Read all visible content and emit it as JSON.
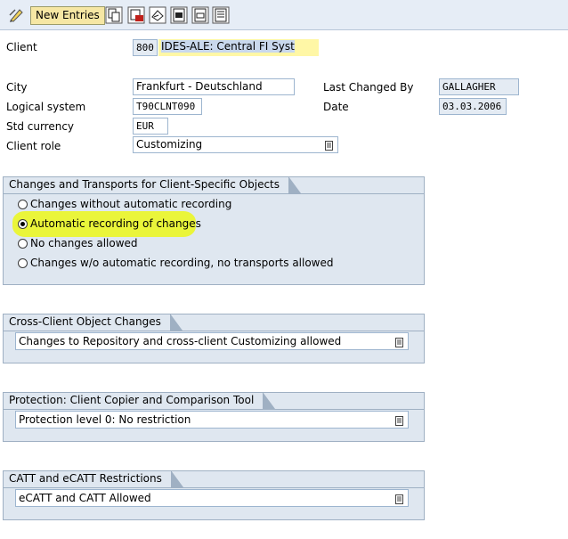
{
  "toolbar": {
    "new_entries_label": "New Entries",
    "icons": [
      "display-change-icon",
      "copy-icon",
      "delete-icon",
      "undo-icon",
      "select-all-icon",
      "select-block-icon",
      "deselect-all-icon"
    ]
  },
  "form": {
    "client_label": "Client",
    "client_value": "800",
    "client_description": "IDES-ALE: Central FI Syst",
    "city_label": "City",
    "city_value": "Frankfurt - Deutschland",
    "logical_system_label": "Logical system",
    "logical_system_value": "T90CLNT090",
    "std_currency_label": "Std currency",
    "std_currency_value": "EUR",
    "client_role_label": "Client role",
    "client_role_value": "Customizing",
    "last_changed_by_label": "Last Changed By",
    "last_changed_by_value": "GALLAGHER",
    "date_label": "Date",
    "date_value": "03.03.2006"
  },
  "changes_group": {
    "title": "Changes and Transports for Client-Specific Objects",
    "options": [
      {
        "label": "Changes without automatic recording",
        "selected": false
      },
      {
        "label": "Automatic recording of changes",
        "selected": true
      },
      {
        "label": "No changes allowed",
        "selected": false
      },
      {
        "label": "Changes w/o automatic recording, no transports allowed",
        "selected": false
      }
    ]
  },
  "cross_client_group": {
    "title": "Cross-Client Object Changes",
    "value": "Changes to Repository and cross-client Customizing allowed"
  },
  "protection_group": {
    "title": "Protection: Client Copier and Comparison Tool",
    "value": "Protection level 0: No restriction"
  },
  "catt_group": {
    "title": "CATT and eCATT Restrictions",
    "value": "eCATT and CATT Allowed"
  },
  "colors": {
    "highlight": "#eaf53a",
    "group_background": "#dfe7f0",
    "toolbar_background": "#e6edf6"
  }
}
